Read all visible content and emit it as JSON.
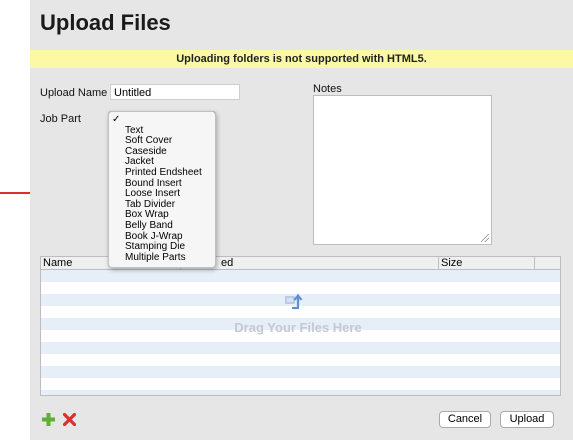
{
  "dialog": {
    "title": "Upload Files",
    "banner": "Uploading folders is not supported with HTML5.",
    "upload_name_label": "Upload Name",
    "upload_name_value": "Untitled",
    "job_part_label": "Job Part",
    "notes_label": "Notes"
  },
  "job_part_menu": {
    "selected_mark": "✓",
    "options": [
      "Text",
      "Soft Cover",
      "Caseside",
      "Jacket",
      "Printed Endsheet",
      "Bound Insert",
      "Loose Insert",
      "Tab Divider",
      "Box Wrap",
      "Belly Band",
      "Book J-Wrap",
      "Stamping Die",
      "Multiple Parts"
    ]
  },
  "table": {
    "col_name": "Name",
    "col_mid": "ed",
    "col_size": "Size",
    "drop_text": "Drag Your Files Here"
  },
  "footer": {
    "cancel_label": "Cancel",
    "upload_label": "Upload"
  },
  "colors": {
    "banner": "#fbf8a6",
    "dialog_bg": "#e6e6e6",
    "row_stripe": "#e6eef8",
    "arrow": "#d9312b",
    "add": "#5bb035",
    "remove": "#d9312b"
  },
  "icons": [
    "arrow-right-icon",
    "add-icon",
    "remove-icon",
    "upload-cloud-icon",
    "resize-grip-icon",
    "check-icon"
  ]
}
